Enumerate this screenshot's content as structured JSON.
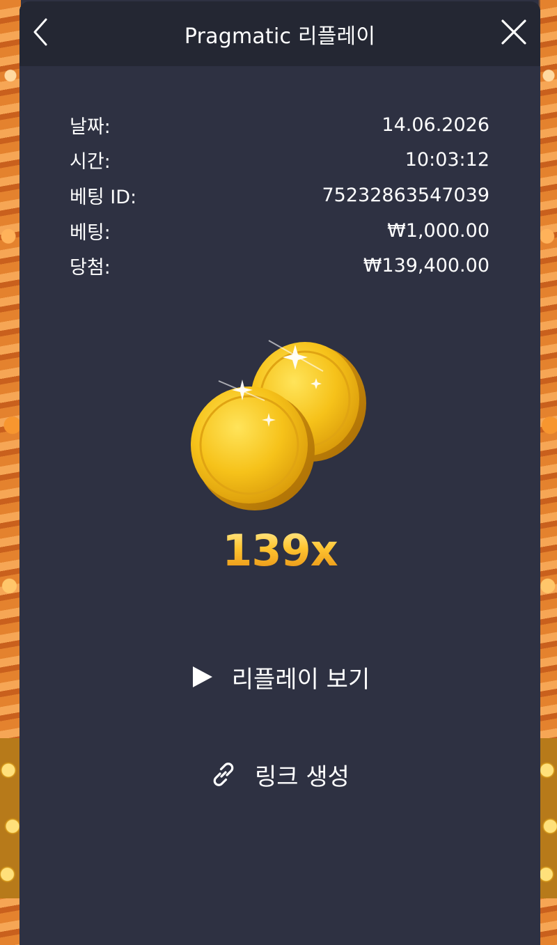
{
  "header": {
    "title": "Pragmatic 리플레이",
    "back_icon": "chevron-left-icon",
    "close_icon": "close-icon"
  },
  "details": [
    {
      "label": "날짜:",
      "value": "14.06.2026"
    },
    {
      "label": "시간:",
      "value": "10:03:12"
    },
    {
      "label": "베팅 ID:",
      "value": "75232863547039"
    },
    {
      "label": "베팅:",
      "value": "₩1,000.00"
    },
    {
      "label": "당첨:",
      "value": "₩139,400.00"
    }
  ],
  "win": {
    "multiplier": "139x",
    "icon": "gold-coins-icon"
  },
  "actions": {
    "watch_replay": "리플레이 보기",
    "watch_replay_icon": "play-icon",
    "create_link": "링크 생성",
    "create_link_icon": "link-icon"
  },
  "colors": {
    "panel_bg": "#2e3142",
    "header_bg": "#242733",
    "text": "#ffffff",
    "gold": "#ffc531"
  }
}
